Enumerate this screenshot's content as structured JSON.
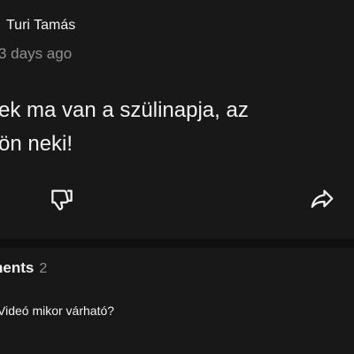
{
  "post": {
    "author": "Turi Tamás",
    "timestamp": "3 days ago",
    "text_line1": "ek ma van a szülinapja, az",
    "text_line2": "ön neki!"
  },
  "actions": {
    "dislike_icon": "thumbs-down-icon",
    "share_icon": "share-icon"
  },
  "comments": {
    "header_label": "nents",
    "count": "2",
    "preview": "Videó mikor várható?"
  }
}
